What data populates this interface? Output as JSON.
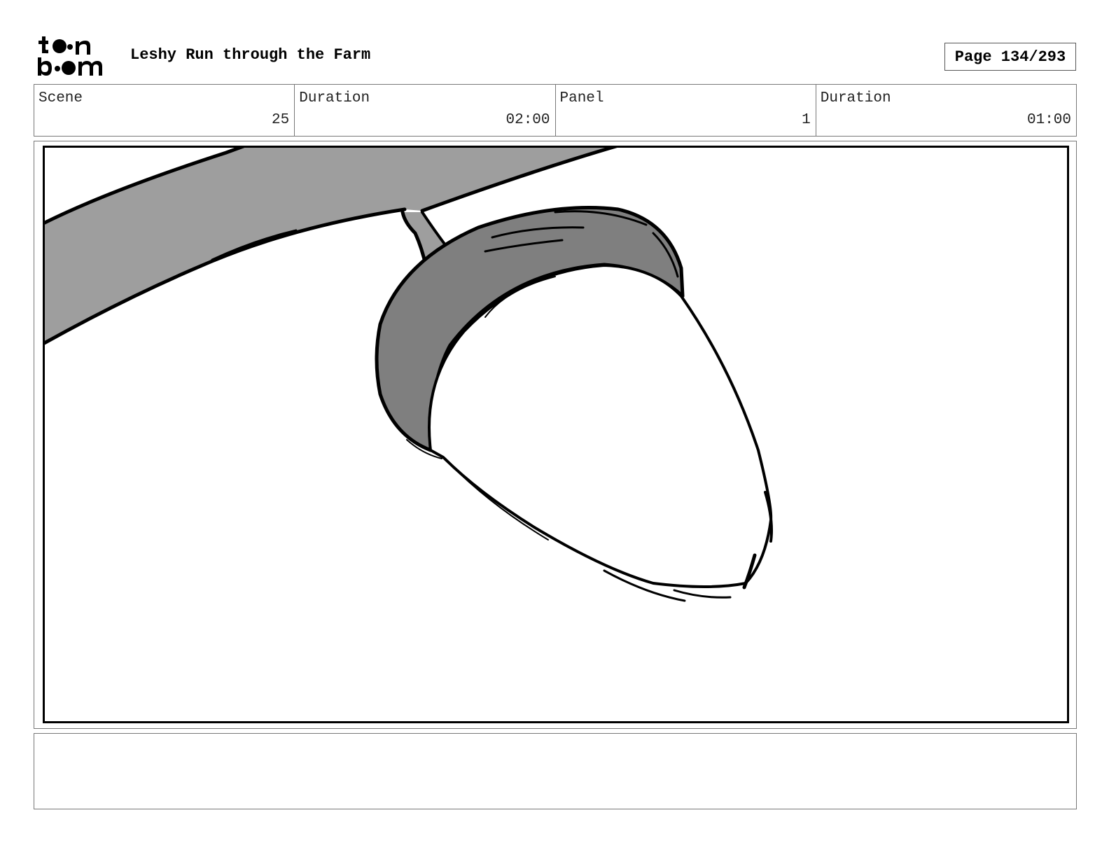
{
  "header": {
    "logo_alt": "toon boom",
    "title": "Leshy Run through the Farm",
    "page_label": "Page 134/293"
  },
  "info": {
    "scene_label": "Scene",
    "scene_value": "25",
    "scene_duration_label": "Duration",
    "scene_duration_value": "02:00",
    "panel_label": "Panel",
    "panel_value": "1",
    "panel_duration_label": "Duration",
    "panel_duration_value": "01:00"
  },
  "notes": {
    "text": ""
  },
  "colors": {
    "branch_fill": "#9e9e9e",
    "cap_fill": "#7f7f7f",
    "line": "#000000"
  }
}
